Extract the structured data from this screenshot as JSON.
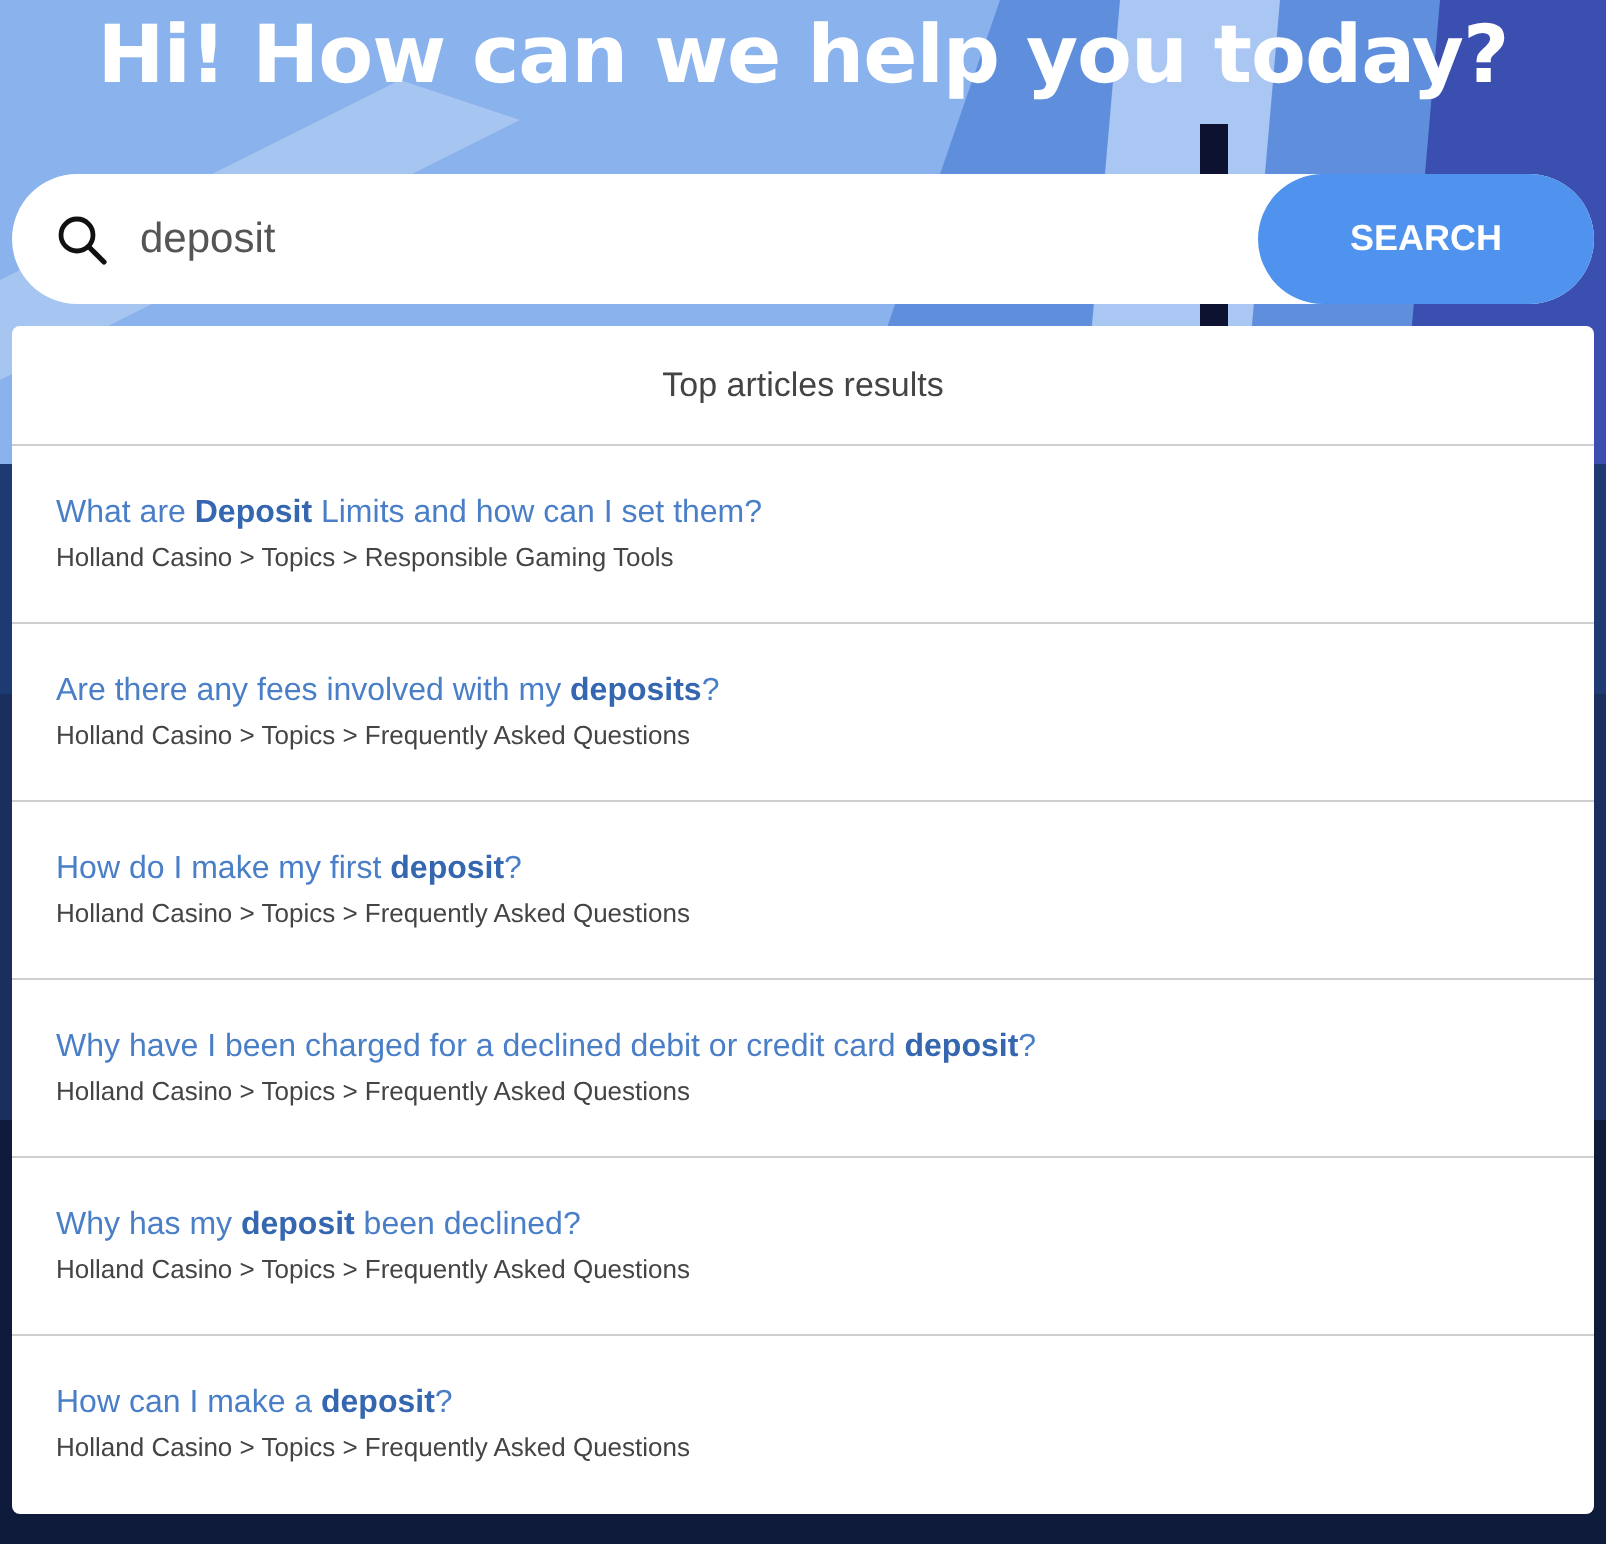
{
  "heading": "Hi! How can we help you today?",
  "search": {
    "value": "deposit",
    "button": "SEARCH"
  },
  "results": {
    "title": "Top articles results",
    "items": [
      {
        "title": "What are **Deposit** Limits and how can I set them?",
        "path": "Holland Casino > Topics > Responsible Gaming Tools"
      },
      {
        "title": "Are there any fees involved with my **deposits**?",
        "path": "Holland Casino > Topics > Frequently Asked Questions"
      },
      {
        "title": "How do I make my first **deposit**?",
        "path": "Holland Casino > Topics > Frequently Asked Questions"
      },
      {
        "title": "Why have I been charged for a declined debit or credit card **deposit**?",
        "path": "Holland Casino > Topics > Frequently Asked Questions"
      },
      {
        "title": "Why has my **deposit** been declined?",
        "path": "Holland Casino > Topics > Frequently Asked Questions"
      },
      {
        "title": "How can I make a **deposit**?",
        "path": "Holland Casino > Topics > Frequently Asked Questions"
      }
    ]
  }
}
